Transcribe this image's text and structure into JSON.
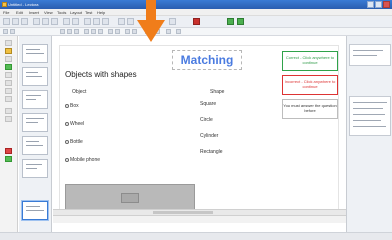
{
  "window": {
    "title": "Untitled - Lectora"
  },
  "menu": [
    "File",
    "Edit",
    "Insert",
    "View",
    "Tools",
    "Layout",
    "Test",
    "Help"
  ],
  "slide": {
    "title": "Matching",
    "heading": "Objects with shapes",
    "object_header": "Object",
    "shape_header": "Shape",
    "objects": [
      "Box",
      "Wheel",
      "Bottle",
      "Mobile phone"
    ],
    "shapes": [
      "Square",
      "Circle",
      "Cylinder",
      "Rectangle"
    ],
    "feedback_correct": "Correct - Click anywhere to continue",
    "feedback_incorrect": "Incorrect - Click anywhere to continue",
    "feedback_answer": "You must answer the question before"
  },
  "colors": {
    "accent": "#4a7be0",
    "correct": "#2f9b48",
    "incorrect": "#dd3333",
    "arrow": "#f07d1a"
  }
}
